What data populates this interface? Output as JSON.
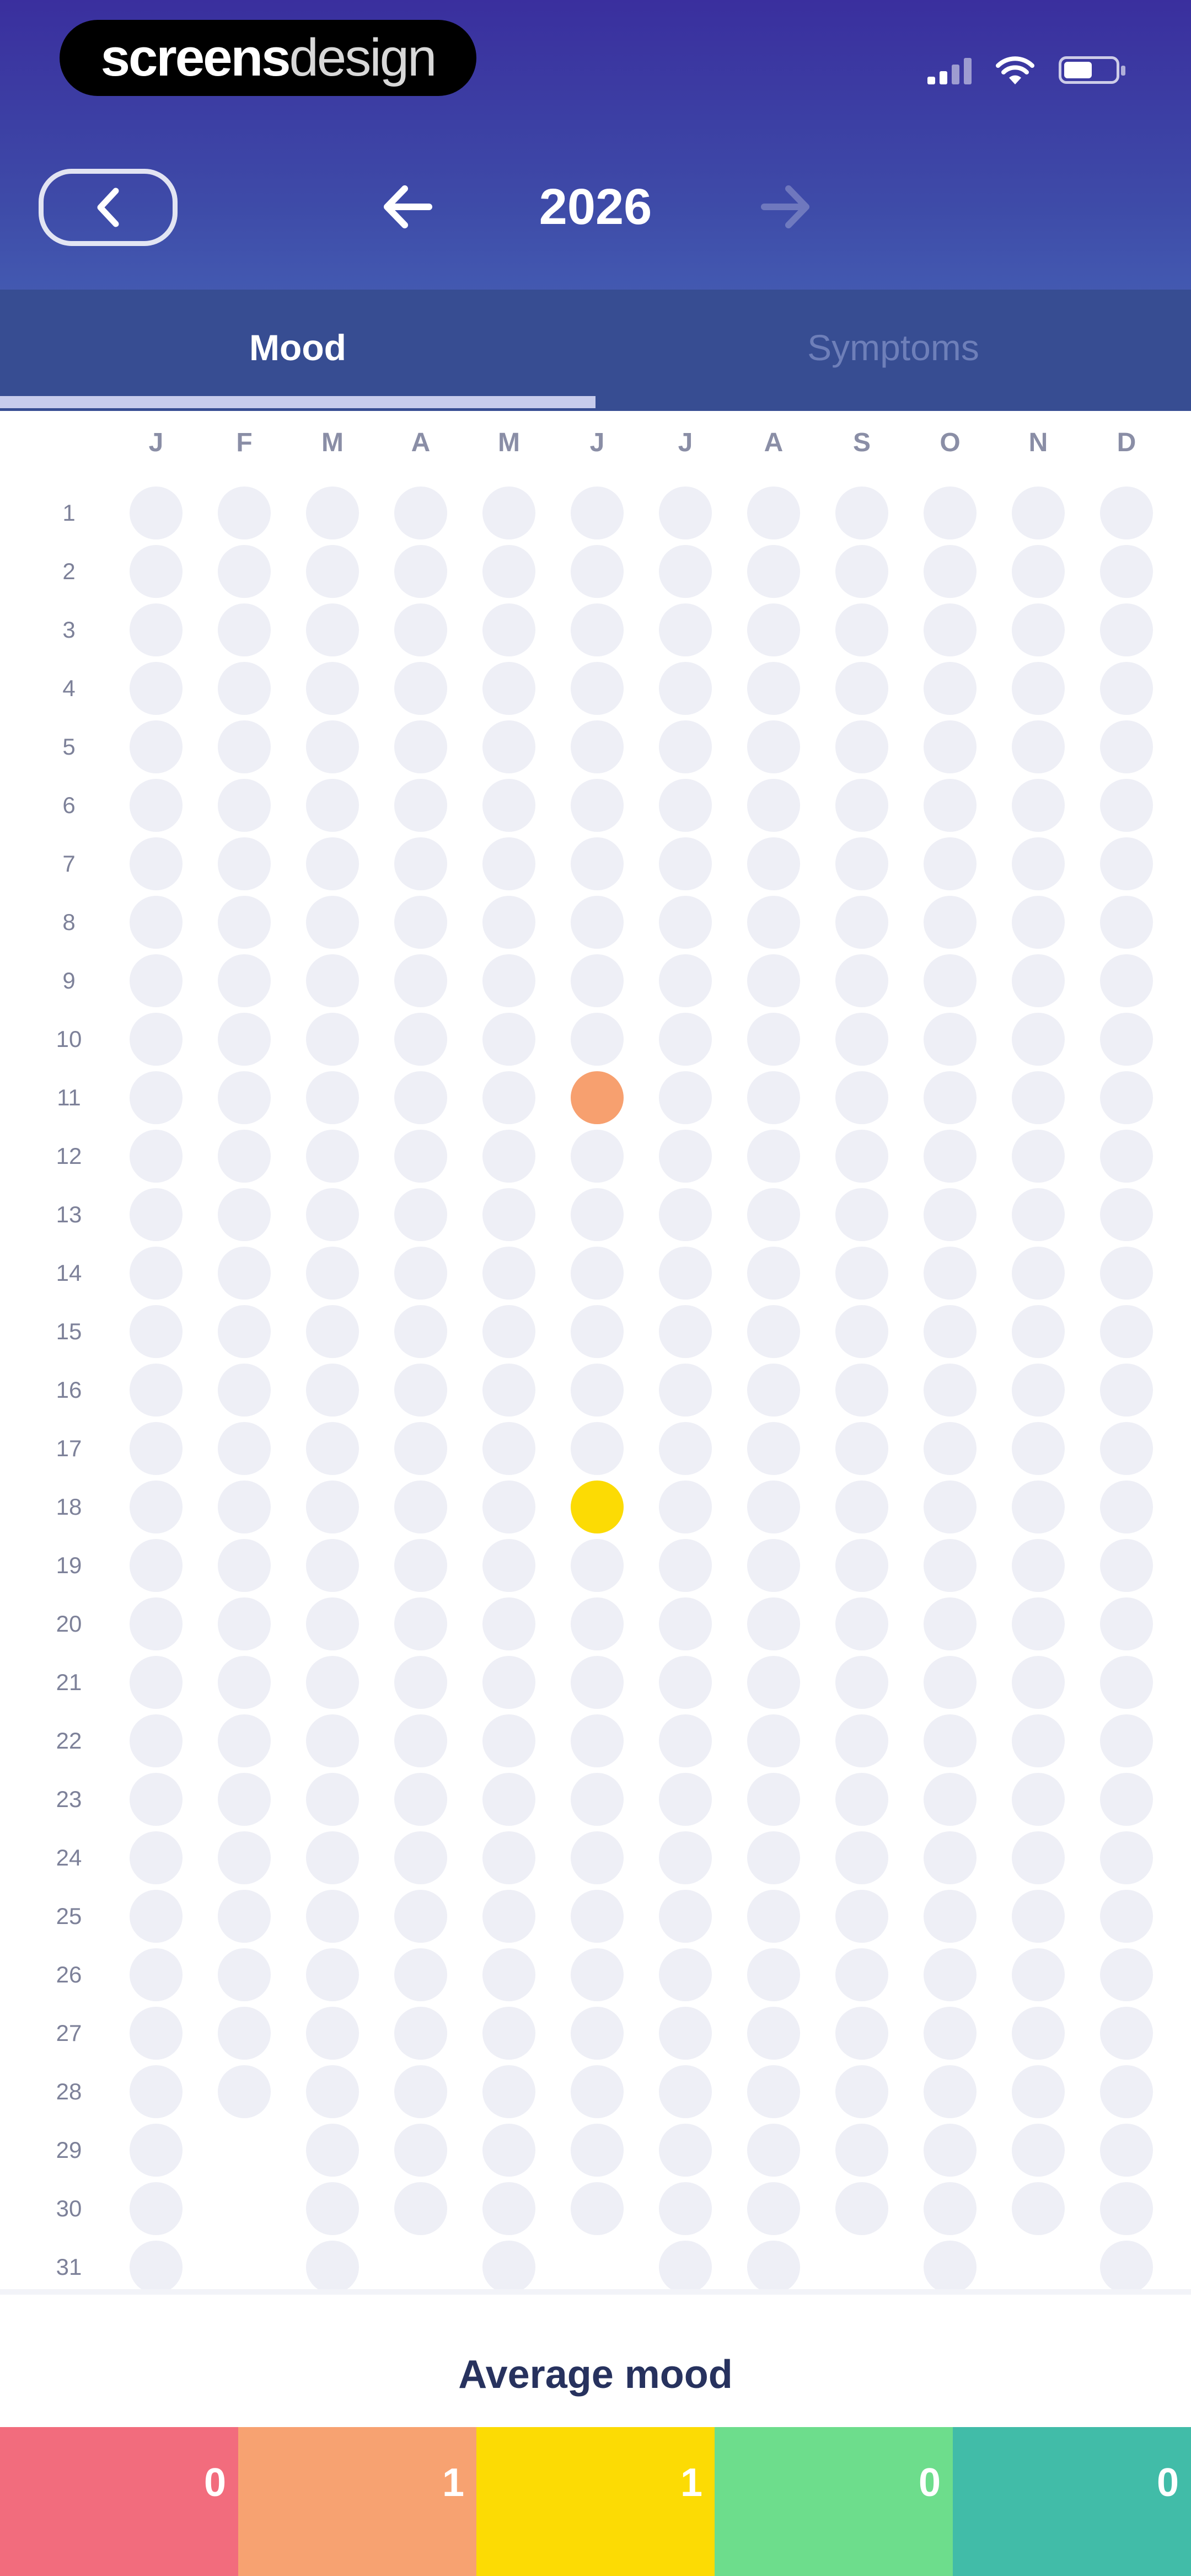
{
  "status_bar": {
    "brand_bold": "screens",
    "brand_light": "design",
    "signal_icon": "signal-bars-icon",
    "wifi_icon": "wifi-icon",
    "battery_icon": "battery-icon",
    "battery_level": 0.55
  },
  "nav": {
    "back_icon": "chevron-left-icon",
    "prev_icon": "arrow-left-icon",
    "next_icon": "arrow-right-icon",
    "year": "2026"
  },
  "tabs": [
    {
      "label": "Mood",
      "active": true
    },
    {
      "label": "Symptoms",
      "active": false
    }
  ],
  "calendar": {
    "months": [
      "J",
      "F",
      "M",
      "A",
      "M",
      "J",
      "J",
      "A",
      "S",
      "O",
      "N",
      "D"
    ],
    "month_lengths": [
      31,
      28,
      31,
      30,
      31,
      30,
      31,
      31,
      30,
      31,
      30,
      31
    ],
    "days": [
      "1",
      "2",
      "3",
      "4",
      "5",
      "6",
      "7",
      "8",
      "9",
      "10",
      "11",
      "12",
      "13",
      "14",
      "15",
      "16",
      "17",
      "18",
      "19",
      "20",
      "21",
      "22",
      "23",
      "24",
      "25",
      "26",
      "27",
      "28",
      "29",
      "30",
      "31"
    ],
    "entries": [
      {
        "month": 6,
        "day": 11,
        "color": "#f7a06f"
      },
      {
        "month": 6,
        "day": 18,
        "color": "#fcdb04"
      }
    ],
    "empty_color": "#eeeff6"
  },
  "average": {
    "title": "Average mood",
    "segments": [
      {
        "value": "0",
        "color": "#f26c7d"
      },
      {
        "value": "1",
        "color": "#f7a271"
      },
      {
        "value": "1",
        "color": "#fcdb04"
      },
      {
        "value": "0",
        "color": "#6ddd8c"
      },
      {
        "value": "0",
        "color": "#41bca8"
      }
    ]
  }
}
